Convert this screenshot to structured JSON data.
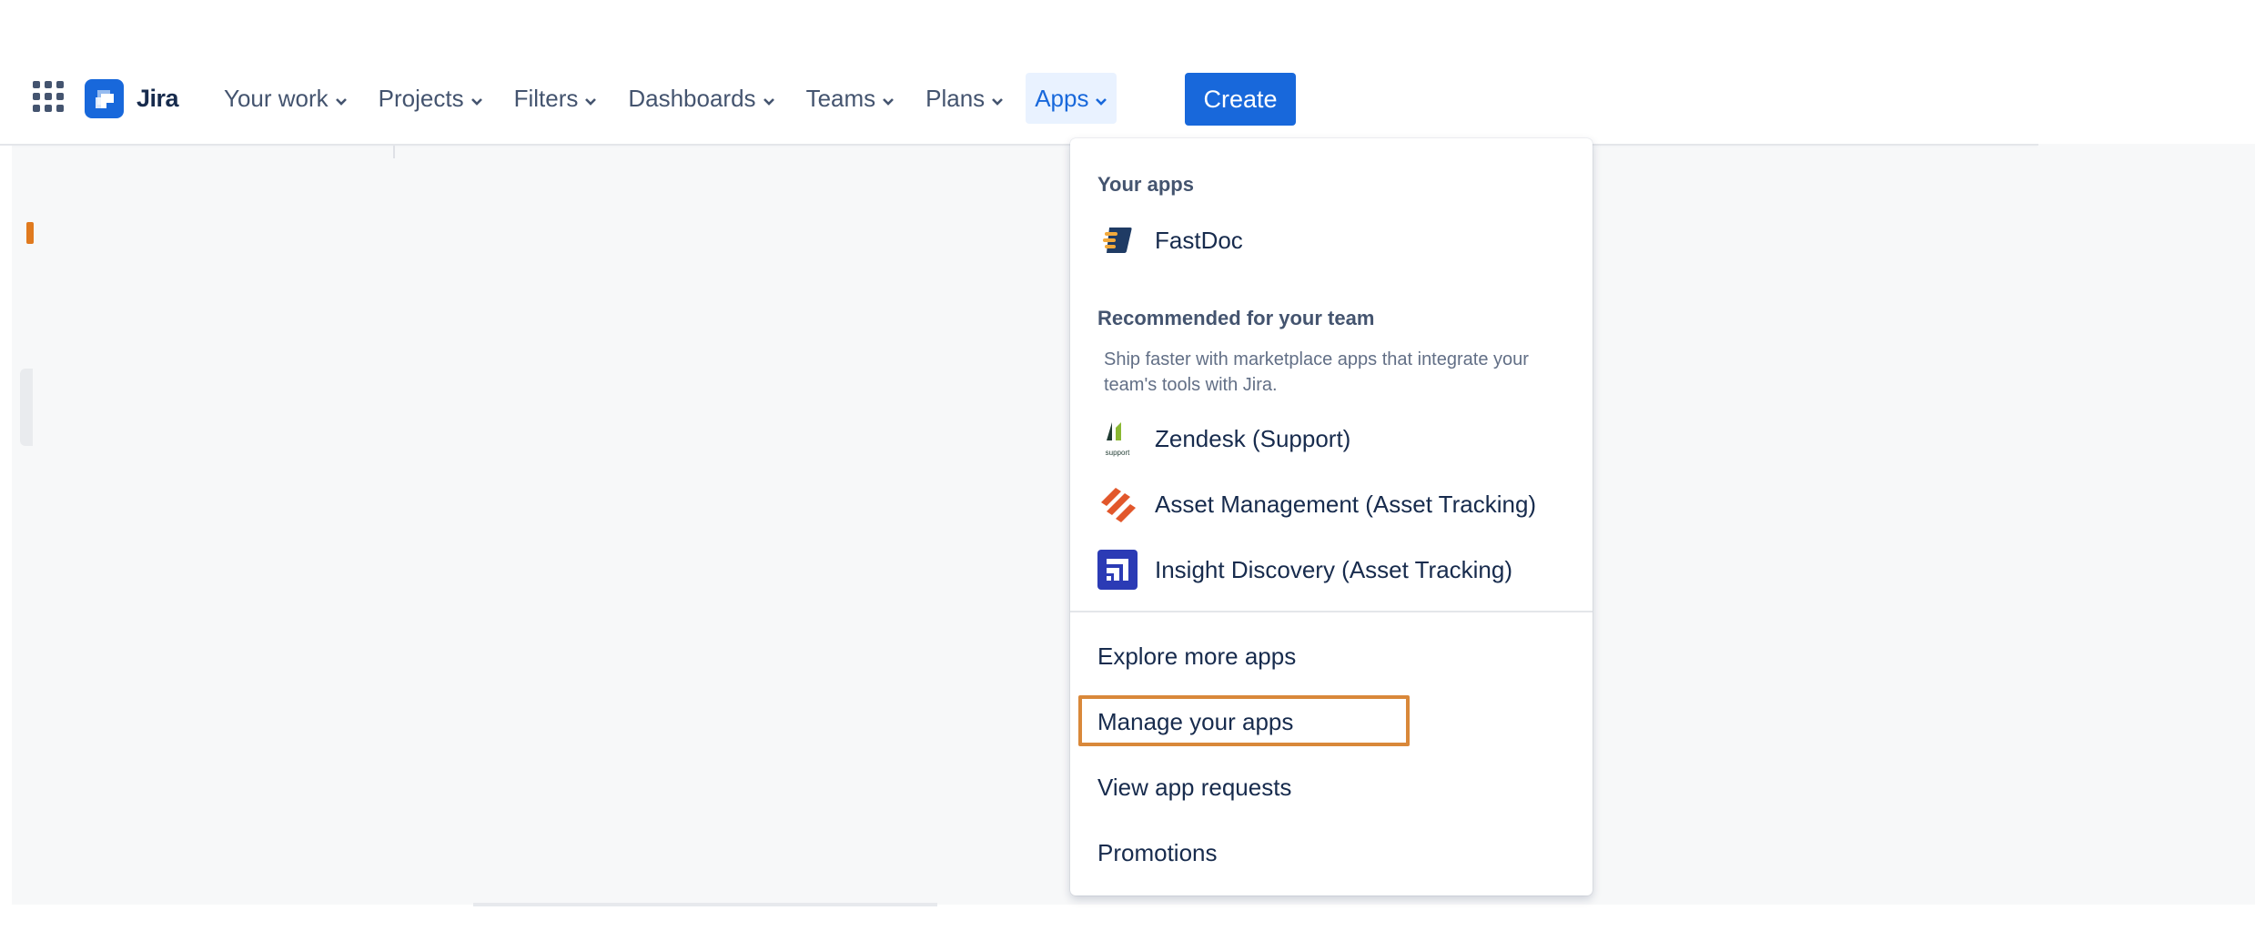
{
  "topnav": {
    "logo_text": "Jira",
    "items": [
      {
        "label": "Your work"
      },
      {
        "label": "Projects"
      },
      {
        "label": "Filters"
      },
      {
        "label": "Dashboards"
      },
      {
        "label": "Teams"
      },
      {
        "label": "Plans"
      },
      {
        "label": "Apps",
        "active": true
      }
    ],
    "create_label": "Create"
  },
  "apps_menu": {
    "your_apps_heading": "Your apps",
    "your_apps": [
      {
        "label": "FastDoc",
        "icon": "fastdoc-icon"
      }
    ],
    "recommended_heading": "Recommended for your team",
    "recommended_description": "Ship faster with marketplace apps that integrate your team's tools with Jira.",
    "recommended": [
      {
        "label": "Zendesk (Support)",
        "icon": "zendesk-icon",
        "icon_caption": "support"
      },
      {
        "label": "Asset Management (Asset Tracking)",
        "icon": "asset-management-icon"
      },
      {
        "label": "Insight Discovery (Asset Tracking)",
        "icon": "insight-discovery-icon"
      }
    ],
    "links": [
      {
        "label": "Explore more apps"
      },
      {
        "label": "Manage your apps",
        "highlighted": true
      },
      {
        "label": "View app requests"
      },
      {
        "label": "Promotions"
      }
    ]
  },
  "colors": {
    "brand": "#1868db",
    "highlight": "#d9883a",
    "nav_text": "#44546f",
    "active_bg": "#e9f2ff"
  }
}
